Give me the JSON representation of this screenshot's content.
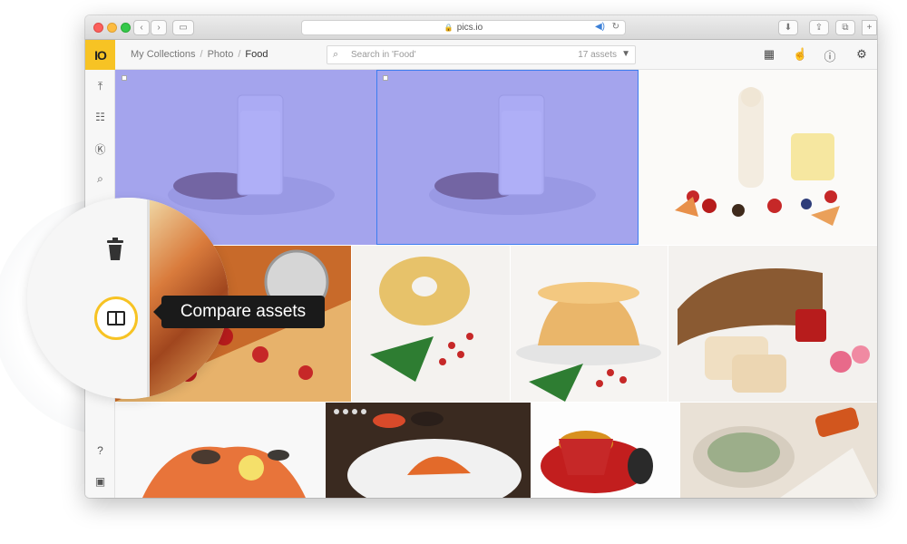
{
  "browser": {
    "url": "pics.io"
  },
  "app": {
    "logo": "IO",
    "breadcrumbs": [
      "My Collections",
      "Photo",
      "Food"
    ],
    "search_placeholder": "Search in 'Food'",
    "asset_count": "17 assets"
  },
  "header_icons": [
    "grid-icon",
    "hand-pointer-icon",
    "info-icon",
    "settings-icon"
  ],
  "sidebar_icons": [
    "upload-icon",
    "tree-icon",
    "keywords-icon",
    "search-icon",
    "lightbulb-icon",
    "help-icon",
    "chat-icon"
  ],
  "lens": {
    "tooltip": "Compare assets"
  },
  "colors": {
    "brand": "#f7c324",
    "selection": "#6e6ef0",
    "selection_border": "#3d7df0"
  }
}
